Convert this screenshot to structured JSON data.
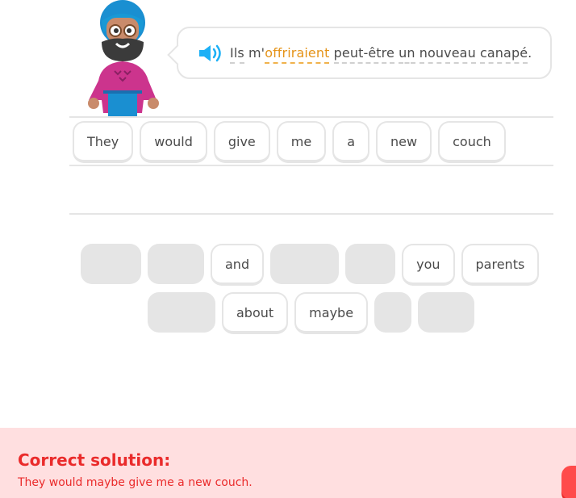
{
  "prompt": {
    "segments": [
      {
        "text": "Ils",
        "style": "word"
      },
      {
        "text": " m'",
        "style": "plain"
      },
      {
        "text": "offriraient",
        "style": "highlight"
      },
      {
        "text": " ",
        "style": "plain"
      },
      {
        "text": "peut-être",
        "style": "word"
      },
      {
        "text": " ",
        "style": "plain"
      },
      {
        "text": "un",
        "style": "word"
      },
      {
        "text": " ",
        "style": "plain"
      },
      {
        "text": "nouveau",
        "style": "word"
      },
      {
        "text": " ",
        "style": "plain"
      },
      {
        "text": "canapé",
        "style": "word"
      },
      {
        "text": ".",
        "style": "plain"
      }
    ],
    "speaker_icon": "speaker-icon",
    "accent_color": "#1cb0f6",
    "highlight_color": "#e59318"
  },
  "answer": {
    "tiles": [
      "They",
      "would",
      "give",
      "me",
      "a",
      "new",
      "couch"
    ]
  },
  "word_bank": {
    "row1": [
      {
        "kind": "slot"
      },
      {
        "kind": "slot"
      },
      {
        "kind": "tile",
        "label": "and"
      },
      {
        "kind": "slot"
      },
      {
        "kind": "slot"
      },
      {
        "kind": "tile",
        "label": "you"
      },
      {
        "kind": "tile",
        "label": "parents"
      }
    ],
    "row2": [
      {
        "kind": "slot"
      },
      {
        "kind": "tile",
        "label": "about"
      },
      {
        "kind": "tile",
        "label": "maybe"
      },
      {
        "kind": "slot"
      },
      {
        "kind": "slot"
      }
    ]
  },
  "feedback": {
    "title": "Correct solution:",
    "solution": "They would maybe give me a new couch.",
    "color": "#ea2b2b",
    "background": "#ffdfe0"
  }
}
